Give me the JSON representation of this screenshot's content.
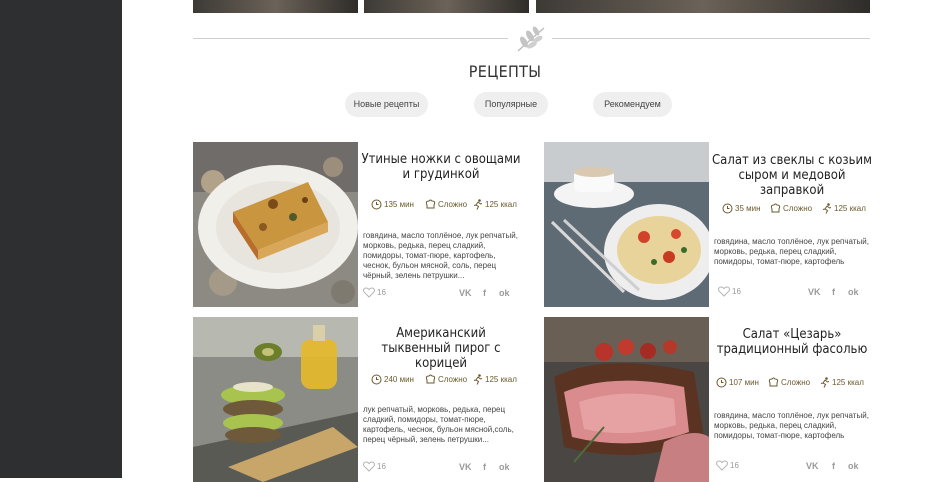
{
  "section": {
    "title": "РЕЦЕПТЫ",
    "tabs": [
      {
        "label": "Новые рецепты"
      },
      {
        "label": "Популярные"
      },
      {
        "label": "Рекомендуем"
      }
    ]
  },
  "recipes": [
    {
      "title": "Утиные ножки с овощами и грудинкой",
      "time": "135 мин",
      "difficulty": "Сложно",
      "calories": "125 ккал",
      "ingredients": "говядина, масло топлёное, лук репчатый, морковь, редька, перец сладкий, помидоры, томат-пюре, картофель, чеснок, бульон мясной, соль, перец чёрный, зелень петрушки...",
      "likes": "16"
    },
    {
      "title": "Салат из свеклы с козьим сыром и медовой заправкой",
      "time": "35 мин",
      "difficulty": "Сложно",
      "calories": "125 ккал",
      "ingredients": "говядина, масло топлёное, лук репчатый, морковь, редька, перец сладкий, помидоры, томат-пюре, картофель",
      "likes": "16"
    },
    {
      "title": "Американский тыквенный пирог с корицей",
      "time": "240 мин",
      "difficulty": "Сложно",
      "calories": "125 ккал",
      "ingredients": "лук репчатый, морковь, редька, перец сладкий, помидоры, томат-пюре, картофель, чеснок, бульон мясной,соль, перец чёрный, зелень петрушки...",
      "likes": "16"
    },
    {
      "title": "Салат «Цезарь» традиционный фасолью",
      "time": "107 мин",
      "difficulty": "Сложно",
      "calories": "125 ккал",
      "ingredients": "говядина, масло топлёное, лук репчатый, морковь, редька, перец сладкий, помидоры, томат-пюре, картофель",
      "likes": "16"
    }
  ],
  "share": {
    "vk": "VK",
    "fb": "f",
    "ok": "ok"
  },
  "icons": {
    "leaf": "leaf-icon",
    "clock": "clock-icon",
    "chef": "chef-hat-icon",
    "run": "runner-icon",
    "heart": "heart-icon"
  }
}
